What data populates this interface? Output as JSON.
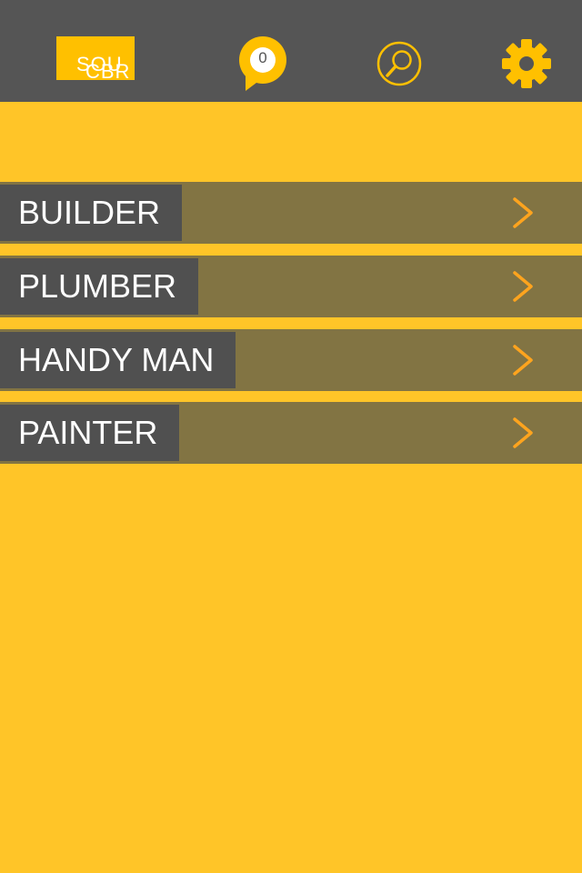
{
  "header": {
    "logo_line1": "SOU",
    "logo_line2": "CBR",
    "notification_count": "0",
    "icons": {
      "messages": "chat-bubble-icon",
      "search": "search-icon",
      "settings": "gear-icon"
    }
  },
  "menu": {
    "items": [
      {
        "label": "BUILDER"
      },
      {
        "label": "PLUMBER"
      },
      {
        "label": "HANDY MAN"
      },
      {
        "label": "PAINTER"
      }
    ],
    "chevron_icon": "chevron-right-icon"
  },
  "colors": {
    "background": "#FFC528",
    "topbar": "#555555",
    "accent": "#FFC000",
    "row_band": "#827443",
    "label_box": "#505050",
    "chevron": "#FFA41E",
    "text": "#FFFFFF"
  }
}
